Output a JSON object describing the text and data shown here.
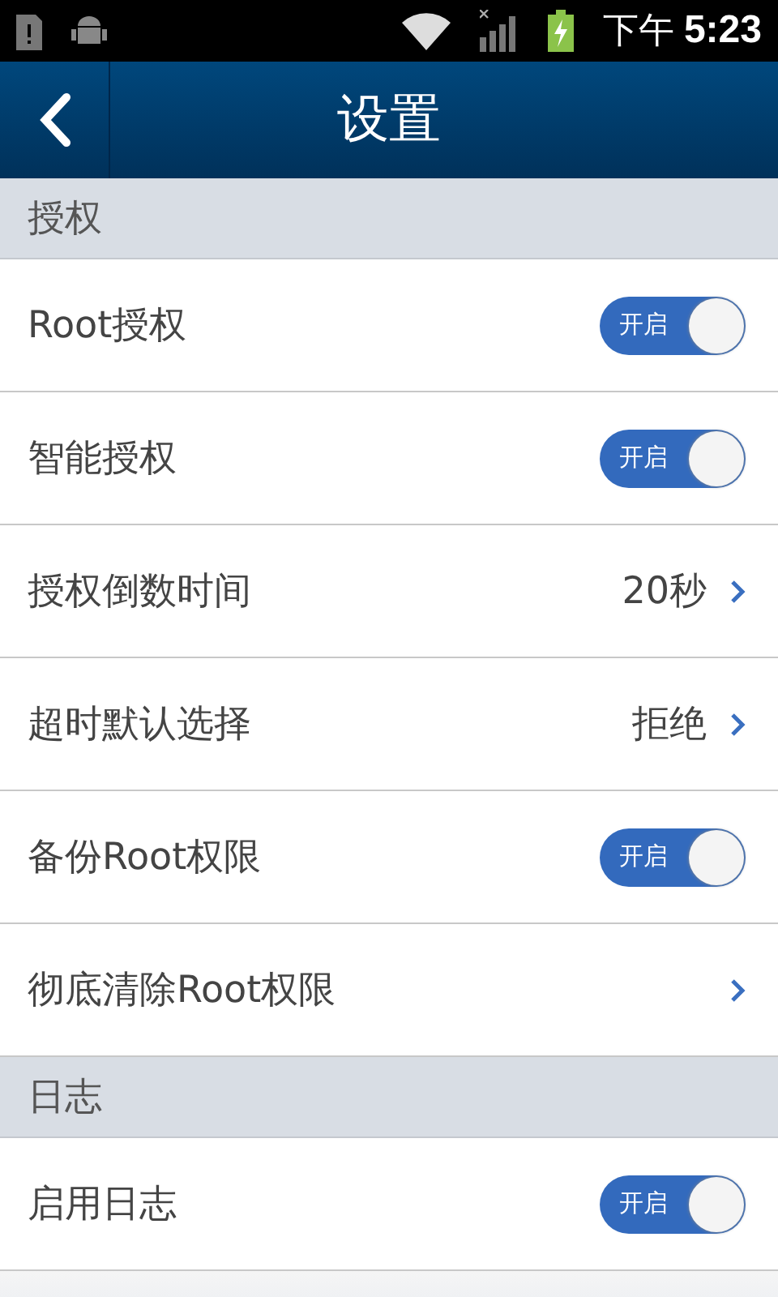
{
  "status_bar": {
    "period": "下午",
    "time": "5:23"
  },
  "header": {
    "title": "设置"
  },
  "sections": [
    {
      "title": "授权",
      "items": [
        {
          "kind": "toggle",
          "label": "Root授权",
          "on": true,
          "toggle_text": "开启"
        },
        {
          "kind": "toggle",
          "label": "智能授权",
          "on": true,
          "toggle_text": "开启"
        },
        {
          "kind": "value",
          "label": "授权倒数时间",
          "value": "20秒"
        },
        {
          "kind": "value",
          "label": "超时默认选择",
          "value": "拒绝"
        },
        {
          "kind": "toggle",
          "label": "备份Root权限",
          "on": true,
          "toggle_text": "开启"
        },
        {
          "kind": "link",
          "label": "彻底清除Root权限"
        }
      ]
    },
    {
      "title": "日志",
      "items": [
        {
          "kind": "toggle",
          "label": "启用日志",
          "on": true,
          "toggle_text": "开启"
        }
      ]
    }
  ]
}
